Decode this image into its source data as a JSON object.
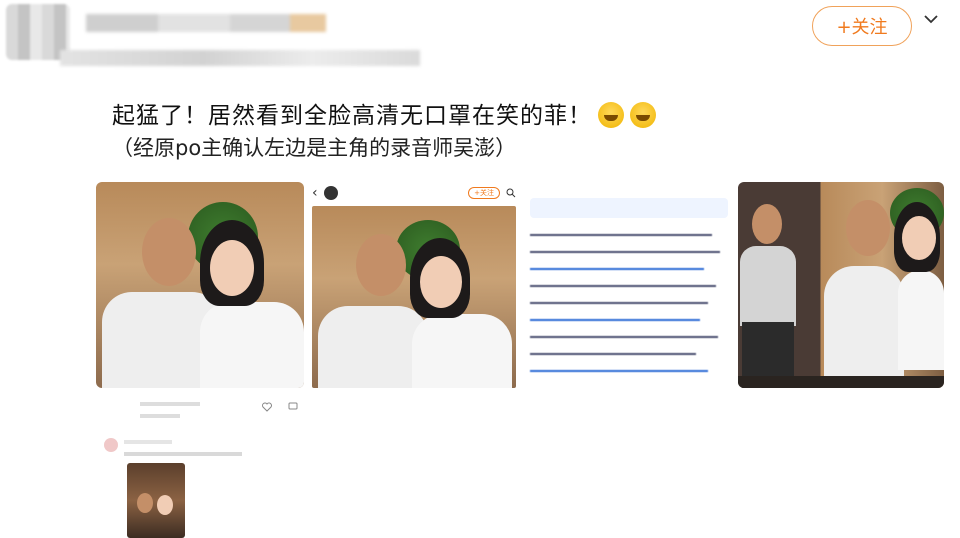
{
  "header": {
    "follow_label": "+关注"
  },
  "post": {
    "line1": "起猛了！居然看到全脸高清无口罩在笑的菲！",
    "line2": "（经原po主确认左边是主角的录音师吴澎）"
  },
  "icons": [
    "chevron-down-icon",
    "back-arrow-icon",
    "search-icon",
    "share-icon",
    "like-icon",
    "comment-icon"
  ],
  "colors": {
    "accent": "#f07a1e",
    "link": "#2d6bd6"
  },
  "screenshot2": {
    "follow_label": "+关注"
  }
}
